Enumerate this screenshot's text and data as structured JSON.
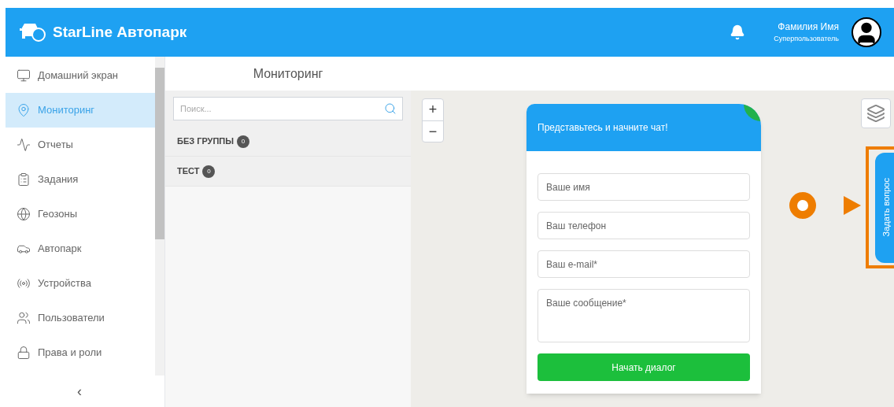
{
  "header": {
    "brand": "StarLine Автопарк",
    "user_name": "Фамилия Имя",
    "user_role": "Суперпользователь"
  },
  "sidebar": {
    "items": [
      {
        "label": "Домашний экран",
        "selected": false
      },
      {
        "label": "Мониторинг",
        "selected": true
      },
      {
        "label": "Отчеты",
        "selected": false
      },
      {
        "label": "Задания",
        "selected": false
      },
      {
        "label": "Геозоны",
        "selected": false
      },
      {
        "label": "Автопарк",
        "selected": false
      },
      {
        "label": "Устройства",
        "selected": false
      },
      {
        "label": "Пользователи",
        "selected": false
      },
      {
        "label": "Права и роли",
        "selected": false
      }
    ],
    "collapse": "‹"
  },
  "panel": {
    "title": "Мониторинг",
    "search": {
      "placeholder": "Поиск..."
    },
    "groups": [
      {
        "name": "БЕЗ ГРУППЫ",
        "count": "0"
      },
      {
        "name": "ТЕСТ",
        "count": "0"
      }
    ]
  },
  "map": {
    "zoom_in": "+",
    "zoom_out": "−"
  },
  "chat": {
    "title": "Представьтесь и начните чат!",
    "fields": [
      {
        "kind": "input",
        "placeholder": "Ваше имя"
      },
      {
        "kind": "input",
        "placeholder": "Ваш телефон"
      },
      {
        "kind": "input",
        "placeholder": "Ваш e-mail*"
      },
      {
        "kind": "textarea",
        "placeholder": "Ваше сообщение*"
      }
    ],
    "button": "Начать диалог",
    "side_tab": "Задать вопрос"
  }
}
